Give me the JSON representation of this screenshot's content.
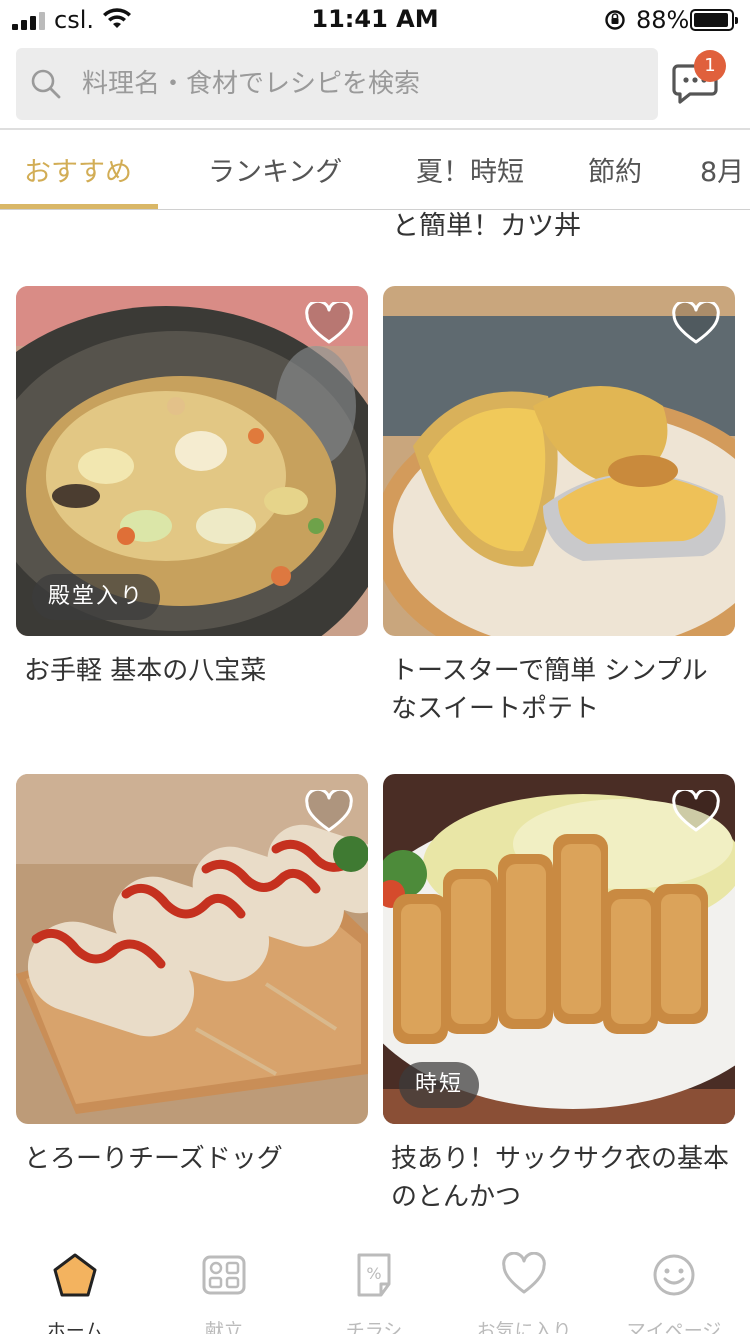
{
  "status_bar": {
    "carrier": "csl.",
    "time": "11:41 AM",
    "battery": "88%"
  },
  "search": {
    "placeholder": "料理名・食材でレシピを検索"
  },
  "header": {
    "chat_badge_count": "1"
  },
  "tabs": [
    {
      "label": "おすすめ",
      "active": true
    },
    {
      "label": "ランキング",
      "active": false
    },
    {
      "label": "夏！時短",
      "active": false
    },
    {
      "label": "節約",
      "active": false
    },
    {
      "label": "8月",
      "active": false
    }
  ],
  "feed": {
    "partial_title": "と簡単！カツ丼",
    "cards": [
      {
        "title": "お手軽 基本の八宝菜",
        "tag": "殿堂入り"
      },
      {
        "title": "トースターで簡単 シンプルなスイートポテト",
        "tag": ""
      },
      {
        "title": "とろーりチーズドッグ",
        "tag": ""
      },
      {
        "title": "技あり！サックサク衣の基本のとんかつ",
        "tag": "時短"
      }
    ]
  },
  "bottom_nav": [
    {
      "label": "ホーム",
      "icon": "home-icon",
      "active": true
    },
    {
      "label": "献立",
      "icon": "menu-icon",
      "active": false
    },
    {
      "label": "チラシ",
      "icon": "flyer-icon",
      "active": false
    },
    {
      "label": "お気に入り",
      "icon": "heart-icon",
      "active": false
    },
    {
      "label": "マイページ",
      "icon": "smiley-icon",
      "active": false
    }
  ],
  "colors": {
    "accent": "#d2ad55",
    "badge": "#e0603c",
    "home_icon_fill": "#f3b35f"
  }
}
